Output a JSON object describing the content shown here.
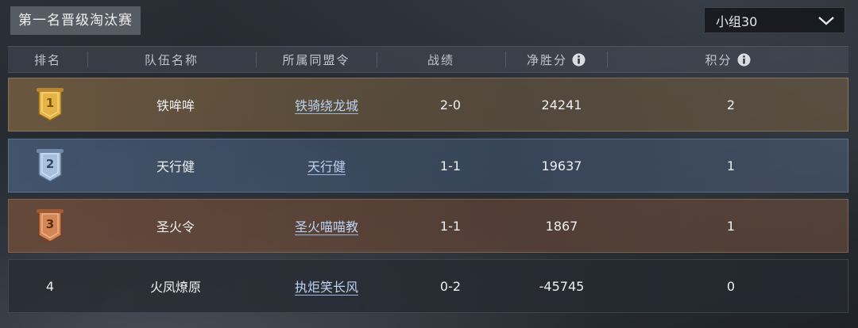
{
  "title": "第一名晋级淘汰赛",
  "group_select": {
    "value": "小组30",
    "icon": "chevron-down-icon"
  },
  "headers": {
    "rank": "排名",
    "team": "队伍名称",
    "alliance": "所属同盟令",
    "record": "战绩",
    "net_score": "净胜分",
    "points": "积分"
  },
  "rows": [
    {
      "rank": "1",
      "team": "铁哞哞",
      "alliance": "铁骑绕龙城",
      "record": "2-0",
      "net_score": "24241",
      "points": "2",
      "tier": "gold"
    },
    {
      "rank": "2",
      "team": "天行健",
      "alliance": "天行健",
      "record": "1-1",
      "net_score": "19637",
      "points": "1",
      "tier": "silver"
    },
    {
      "rank": "3",
      "team": "圣火令",
      "alliance": "圣火喵喵教",
      "record": "1-1",
      "net_score": "1867",
      "points": "1",
      "tier": "bronze"
    },
    {
      "rank": "4",
      "team": "火凤燎原",
      "alliance": "执炬笑长风",
      "record": "0-2",
      "net_score": "-45745",
      "points": "0",
      "tier": "none"
    }
  ],
  "colors": {
    "gold": "#d8a63a",
    "silver": "#9fb8d6",
    "bronze": "#c9794a"
  }
}
